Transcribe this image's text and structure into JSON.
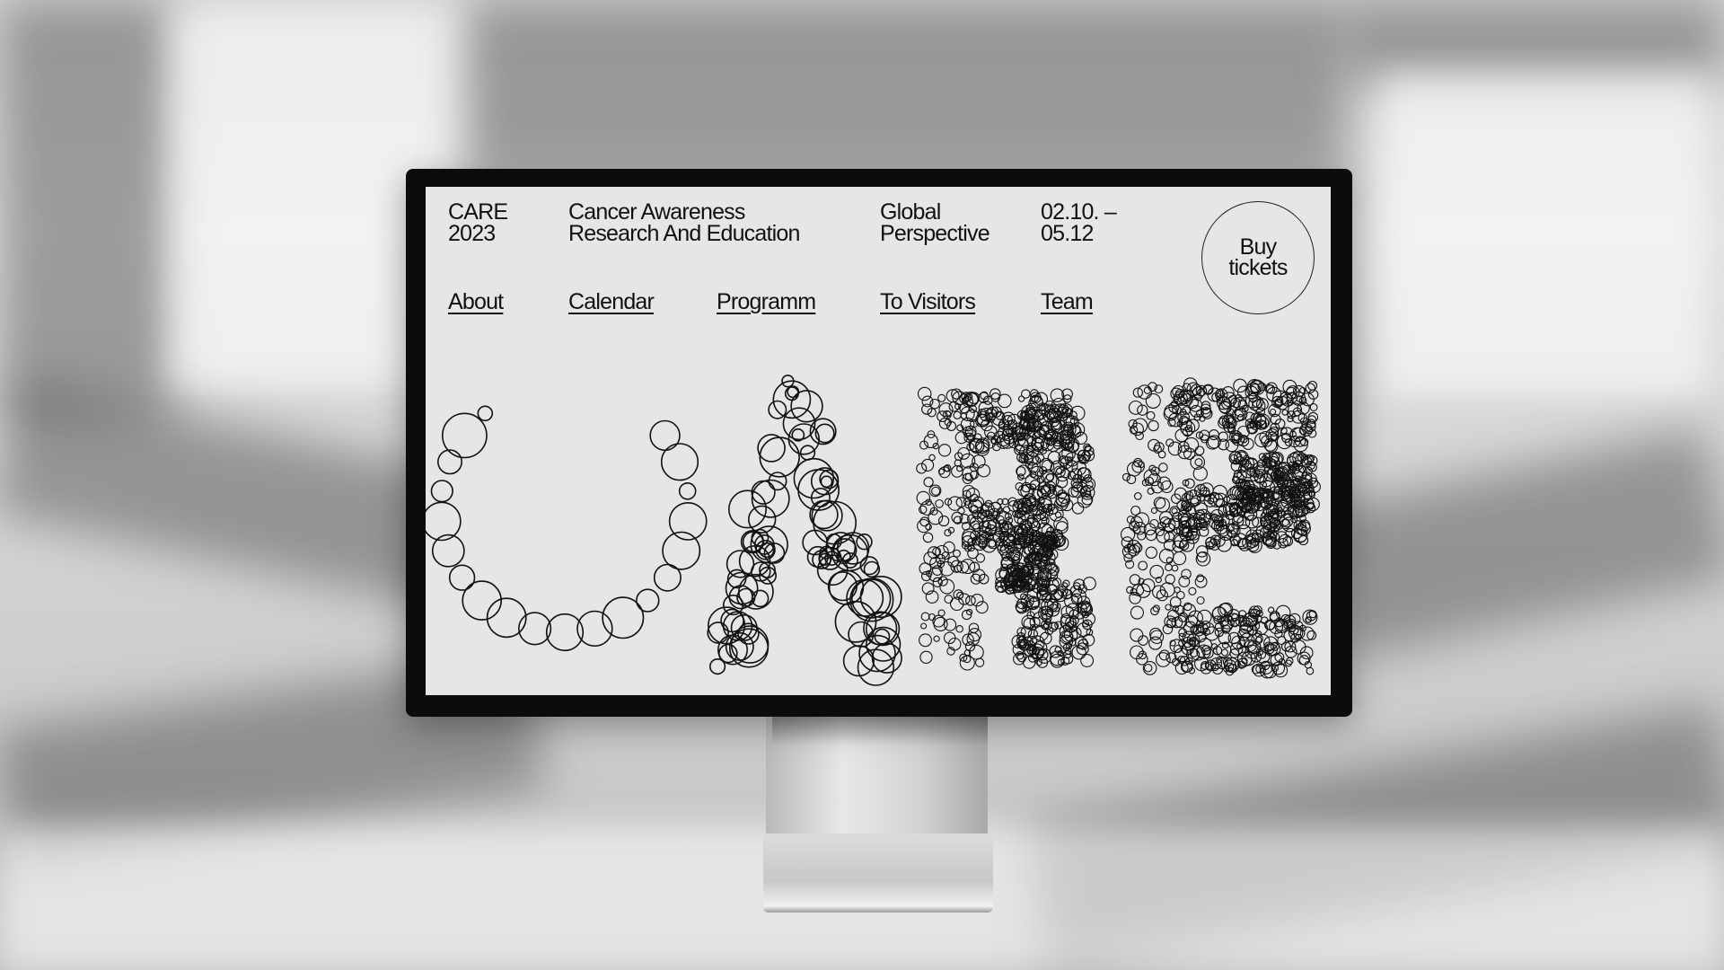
{
  "site": {
    "brand": {
      "line1": "CARE",
      "line2": "2023"
    },
    "subtitle": {
      "line1": "Cancer Awareness",
      "line2": "Research And Education"
    },
    "tagline": {
      "line1": "Global",
      "line2": "Perspective"
    },
    "dates": {
      "line1": "02.10. –",
      "line2": "05.12"
    },
    "buy_button": {
      "line1": "Buy",
      "line2": "tickets"
    },
    "nav": [
      {
        "label": "About"
      },
      {
        "label": "Calendar"
      },
      {
        "label": "Programm"
      },
      {
        "label": "To Visitors"
      },
      {
        "label": "Team"
      }
    ],
    "hero_word": "CARE"
  },
  "colors": {
    "screen_bg": "#e6e6e6",
    "ink": "#111111",
    "bezel": "#0c0c0c"
  }
}
